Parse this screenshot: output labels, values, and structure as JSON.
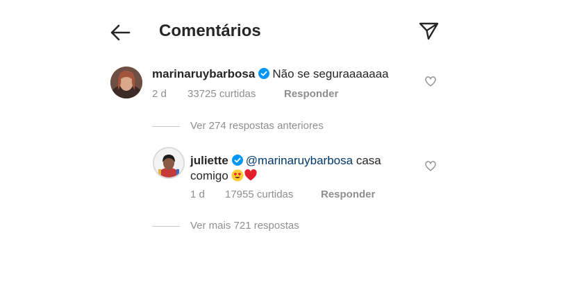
{
  "header": {
    "title": "Comentários"
  },
  "comments": [
    {
      "username": "marinaruybarbosa",
      "text": "Não se seguraaaaaaa",
      "time": "2 d",
      "likes": "33725 curtidas",
      "reply_label": "Responder"
    }
  ],
  "thread": {
    "previous_label": "Ver 274 respostas anteriores",
    "more_label": "Ver mais 721 respostas"
  },
  "reply": {
    "username": "juliette",
    "mention": "@marinaruybarbosa",
    "text_after_mention": "casa",
    "text_line2": "comigo",
    "time": "1 d",
    "likes": "17955 curtidas",
    "reply_label": "Responder"
  },
  "colors": {
    "text": "#262626",
    "muted": "#8e8e8e",
    "verified": "#0095f6",
    "mention": "#00376b"
  },
  "icons": [
    "back-arrow-icon",
    "direct-share-icon",
    "verified-badge-icon",
    "heart-icon",
    "smiling-face-with-heart-eyes-emoji",
    "red-heart-emoji"
  ]
}
